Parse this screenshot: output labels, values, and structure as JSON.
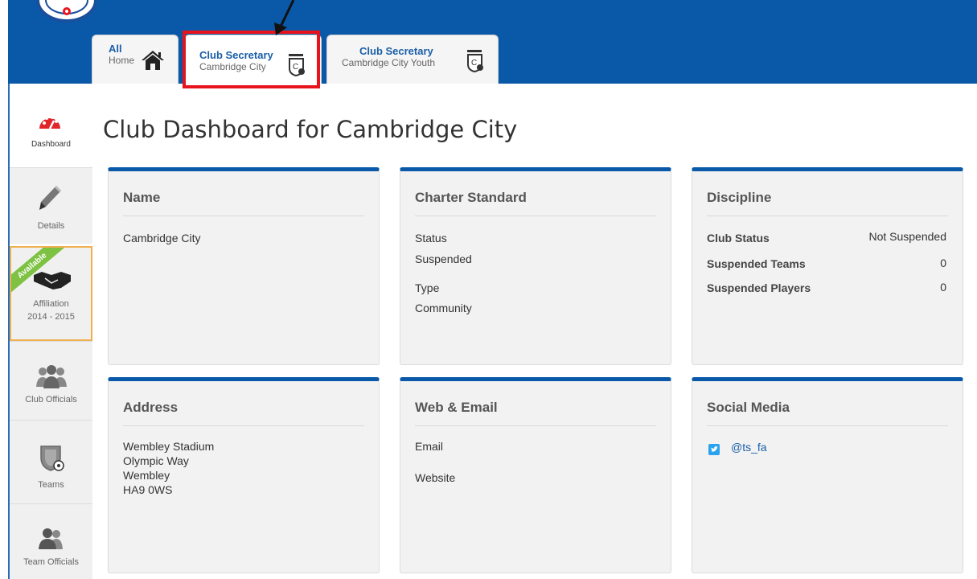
{
  "tabs": [
    {
      "line1": "All",
      "line2": "Home"
    },
    {
      "line1": "Club Secretary",
      "line2": "Cambridge City"
    },
    {
      "line1": "Club Secretary",
      "line2": "Cambridge City Youth"
    }
  ],
  "sidebar": {
    "items": [
      {
        "label": "Dashboard"
      },
      {
        "label": "Details"
      },
      {
        "label": "Affiliation",
        "sublabel": "2014 - 2015",
        "ribbon": "Available"
      },
      {
        "label": "Club Officials"
      },
      {
        "label": "Teams"
      },
      {
        "label": "Team Officials"
      }
    ]
  },
  "page_title": "Club Dashboard for Cambridge City",
  "cards": {
    "name": {
      "title": "Name",
      "value": "Cambridge City"
    },
    "charter": {
      "title": "Charter Standard",
      "status_label": "Status",
      "status_value": "Suspended",
      "type_label": "Type",
      "type_value": "Community"
    },
    "discipline": {
      "title": "Discipline",
      "rows": [
        {
          "label": "Club Status",
          "value": "Not Suspended"
        },
        {
          "label": "Suspended Teams",
          "value": "0"
        },
        {
          "label": "Suspended Players",
          "value": "0"
        }
      ]
    },
    "address": {
      "title": "Address",
      "lines": [
        "Wembley Stadium",
        "Olympic Way",
        "Wembley",
        "HA9 0WS"
      ]
    },
    "web": {
      "title": "Web & Email",
      "email_label": "Email",
      "website_label": "Website"
    },
    "social": {
      "title": "Social Media",
      "twitter_handle": "@ts_fa"
    }
  },
  "colors": {
    "header_blue": "#0a59a8",
    "highlight_red": "#e8141b",
    "ribbon_green": "#7dc242",
    "affiliation_border": "#f0b050"
  },
  "icons": {
    "home_tab": "home-icon",
    "club_tabs": "club-shield-icon",
    "dashboard": "dashboard-gauge-icon",
    "details": "pencil-icon",
    "affiliation": "handshake-icon",
    "club_officials": "people-group-icon",
    "teams": "shield-ball-icon",
    "team_officials": "people-icon",
    "twitter": "twitter-icon"
  }
}
